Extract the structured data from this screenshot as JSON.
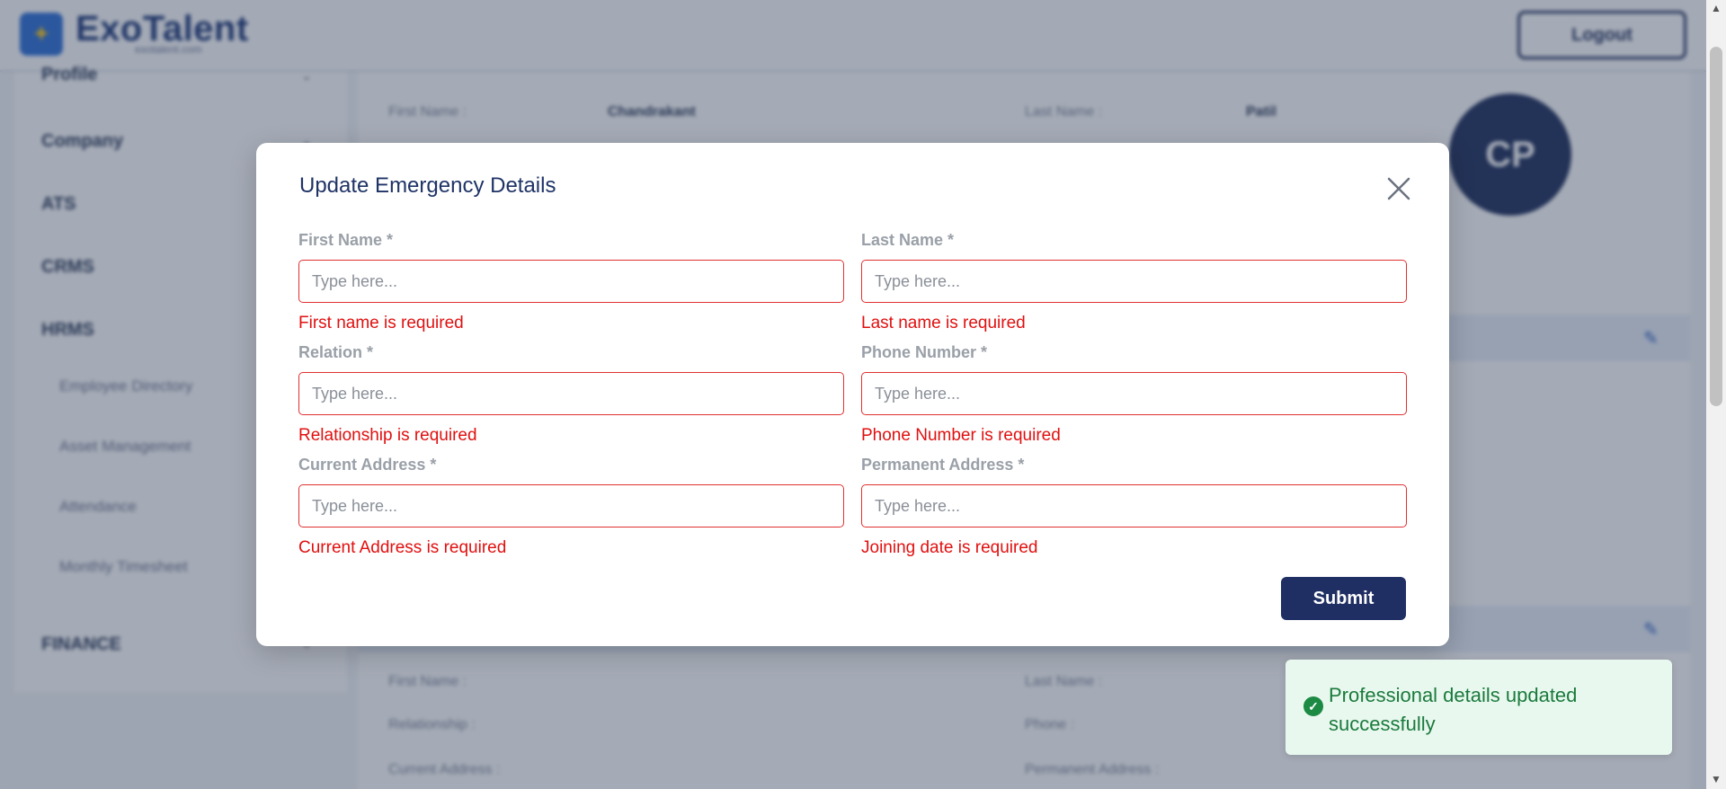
{
  "app": {
    "logo_text": "ExoTalent",
    "logo_subtext": "exotalent.com",
    "logout_label": "Logout"
  },
  "sidebar": {
    "items": [
      {
        "label": "Profile"
      },
      {
        "label": "Company"
      },
      {
        "label": "ATS"
      },
      {
        "label": "CRMS"
      },
      {
        "label": "HRMS"
      },
      {
        "label": "Employee Directory"
      },
      {
        "label": "Asset Management"
      },
      {
        "label": "Attendance"
      },
      {
        "label": "Monthly Timesheet"
      },
      {
        "label": "FINANCE"
      }
    ]
  },
  "background": {
    "avatar_initials": "CP",
    "profile": {
      "first_name_label": "First Name :",
      "first_name_value": "Chandrakant",
      "last_name_label": "Last Name :",
      "last_name_value": "Patil"
    },
    "emergency": {
      "first_name_label": "First Name :",
      "last_name_label": "Last Name :",
      "relationship_label": "Relationship :",
      "phone_label": "Phone :",
      "current_address_label": "Current Address :",
      "permanent_address_label": "Permanent Address :"
    }
  },
  "modal": {
    "title": "Update Emergency Details",
    "fields": [
      {
        "label": "First Name *",
        "placeholder": "Type here...",
        "value": "",
        "error": "First name is required"
      },
      {
        "label": "Last Name *",
        "placeholder": "Type here...",
        "value": "",
        "error": "Last name is required"
      },
      {
        "label": "Relation *",
        "placeholder": "Type here...",
        "value": "",
        "error": "Relationship is required"
      },
      {
        "label": "Phone Number *",
        "placeholder": "Type here...",
        "value": "",
        "error": "Phone Number is required"
      },
      {
        "label": "Current Address *",
        "placeholder": "Type here...",
        "value": "",
        "error": "Current Address is required"
      },
      {
        "label": "Permanent Address *",
        "placeholder": "Type here...",
        "value": "",
        "error": "Joining date is required"
      }
    ],
    "submit_label": "Submit"
  },
  "toast": {
    "message": "Professional details updated successfully",
    "icon": "check-circle-icon"
  },
  "colors": {
    "primary": "#1f2f64",
    "error": "#e01010",
    "success": "#1a7a3c",
    "success_bg": "#e9f8ef"
  }
}
